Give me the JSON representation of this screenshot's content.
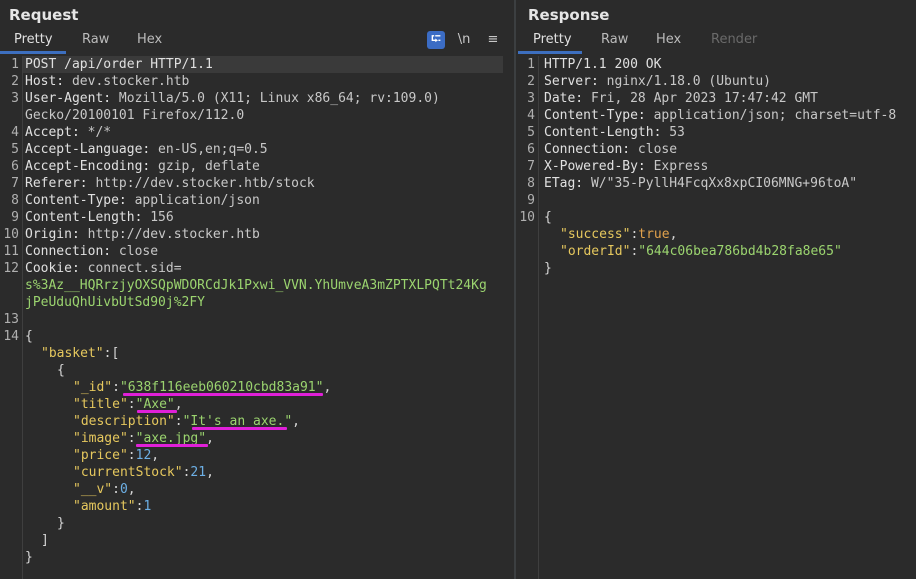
{
  "request": {
    "title": "Request",
    "tabs": [
      "Pretty",
      "Raw",
      "Hex"
    ],
    "tools": {
      "wrap": "⮓",
      "newline": "\\n",
      "menu": "≡"
    },
    "line_numbers": [
      "1",
      "2",
      "3",
      "",
      "4",
      "5",
      "6",
      "7",
      "8",
      "9",
      "10",
      "11",
      "12",
      "",
      "",
      "13",
      "14"
    ],
    "lines": {
      "l1": "POST /api/order HTTP/1.1",
      "l2n": "Host:",
      "l2v": " dev.stocker.htb",
      "l3n": "User-Agent:",
      "l3v": " Mozilla/5.0 (X11; Linux x86_64; rv:109.0)",
      "l3b": "Gecko/20100101 Firefox/112.0",
      "l4n": "Accept:",
      "l4v": " */*",
      "l5n": "Accept-Language:",
      "l5v": " en-US,en;q=0.5",
      "l6n": "Accept-Encoding:",
      "l6v": " gzip, deflate",
      "l7n": "Referer:",
      "l7v": " http://dev.stocker.htb/stock",
      "l8n": "Content-Type:",
      "l8v": " application/json",
      "l9n": "Content-Length:",
      "l9v": " 156",
      "l10n": "Origin:",
      "l10v": " http://dev.stocker.htb",
      "l11n": "Connection:",
      "l11v": " close",
      "l12n": "Cookie:",
      "l12v": " connect.sid=",
      "l12b": "s%3Az__HQRrzjyOXSQpWDORCdJk1Pxwi_VVN.YhUmveA3mZPTXLPQTt24Kg",
      "l12c": "jPeUduQhUivbUtSd90j%2FY",
      "brace_open": "{",
      "basket_key": "\"basket\"",
      "basket_punct": ":[",
      "obj_open": "{",
      "id_key": "\"_id\"",
      "id_val": "\"638f116eeb060210cbd83a91\"",
      "title_key": "\"title\"",
      "title_val": "\"Axe\"",
      "desc_key": "\"description\"",
      "desc_val": "\"It's an axe.\"",
      "image_key": "\"image\"",
      "image_val": "\"axe.jpg\"",
      "price_key": "\"price\"",
      "price_val": "12",
      "stock_key": "\"currentStock\"",
      "stock_val": "21",
      "v_key": "\"__v\"",
      "v_val": "0",
      "amount_key": "\"amount\"",
      "amount_val": "1",
      "obj_close": "}",
      "arr_close": "]",
      "brace_close": "}"
    }
  },
  "response": {
    "title": "Response",
    "tabs": [
      "Pretty",
      "Raw",
      "Hex",
      "Render"
    ],
    "line_numbers": [
      "1",
      "2",
      "3",
      "4",
      "5",
      "6",
      "7",
      "8",
      "9",
      "10"
    ],
    "lines": {
      "l1": "HTTP/1.1 200 OK",
      "l2n": "Server:",
      "l2v": " nginx/1.18.0 (Ubuntu)",
      "l3n": "Date:",
      "l3v": " Fri, 28 Apr 2023 17:47:42 GMT",
      "l4n": "Content-Type:",
      "l4v": " application/json; charset=utf-8",
      "l5n": "Content-Length:",
      "l5v": " 53",
      "l6n": "Connection:",
      "l6v": " close",
      "l7n": "X-Powered-By:",
      "l7v": " Express",
      "l8n": "ETag:",
      "l8v": " W/\"35-PyllH4FcqXx8xpCI06MNG+96toA\"",
      "brace_open": "{",
      "success_key": "\"success\"",
      "success_val": "true",
      "order_key": "\"orderId\"",
      "order_val": "\"644c06bea786bd4b28fa8e65\"",
      "brace_close": "}"
    }
  },
  "colors": {
    "background": "#2b2b2b",
    "highlight_underline": "#e020d8",
    "tab_underline": "#3d6fbf",
    "json_key": "#e6c85e",
    "json_string": "#9bd46f",
    "json_number": "#6db0e6",
    "json_bool": "#e2a24c"
  }
}
